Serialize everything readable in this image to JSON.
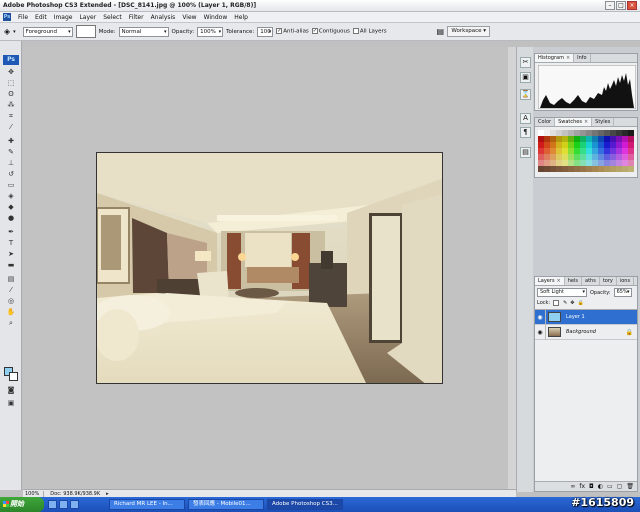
{
  "window": {
    "title": "Adobe Photoshop CS3 Extended - [DSC_8141.jpg @ 100% (Layer 1, RGB/8)]"
  },
  "menu": [
    "File",
    "Edit",
    "Image",
    "Layer",
    "Select",
    "Filter",
    "Analysis",
    "View",
    "Window",
    "Help"
  ],
  "options": {
    "preset": "Foreground",
    "mode_label": "Mode:",
    "mode_value": "Normal",
    "opacity_label": "Opacity:",
    "opacity_value": "100%",
    "tolerance_label": "Tolerance:",
    "tolerance_value": "100",
    "antialias": "Anti-alias",
    "contiguous": "Contiguous",
    "all_layers": "All Layers",
    "workspace": "Workspace ▾"
  },
  "toolbox": {
    "logo": "Ps"
  },
  "status": {
    "zoom": "100%",
    "doc": "Doc: 938.9K/938.9K"
  },
  "panels": {
    "histogram_tabs": [
      "Histogram",
      "Info"
    ],
    "color_tabs": [
      "Color",
      "Swatches",
      "Styles"
    ],
    "layers_tabs": [
      "Layers",
      "hels",
      "aths",
      "tory",
      "ions"
    ],
    "blend_mode": "Soft Light",
    "opacity_label": "Opacity:",
    "opacity_value": "65%",
    "lock_label": "Lock:",
    "layers": [
      {
        "name": "Layer 1",
        "selected": true
      },
      {
        "name": "Background",
        "selected": false
      }
    ]
  },
  "taskbar": {
    "start": "開始",
    "items": [
      "Richard MR LEE - In...",
      "發表回應 - Mobile01...",
      "Adobe Photoshop CS3..."
    ]
  },
  "watermark": "#1615809",
  "colors": {
    "taskbar": "#1c4fb8",
    "layer_selected": "#2f6fd0",
    "fg_color": "#8fd0f0"
  }
}
